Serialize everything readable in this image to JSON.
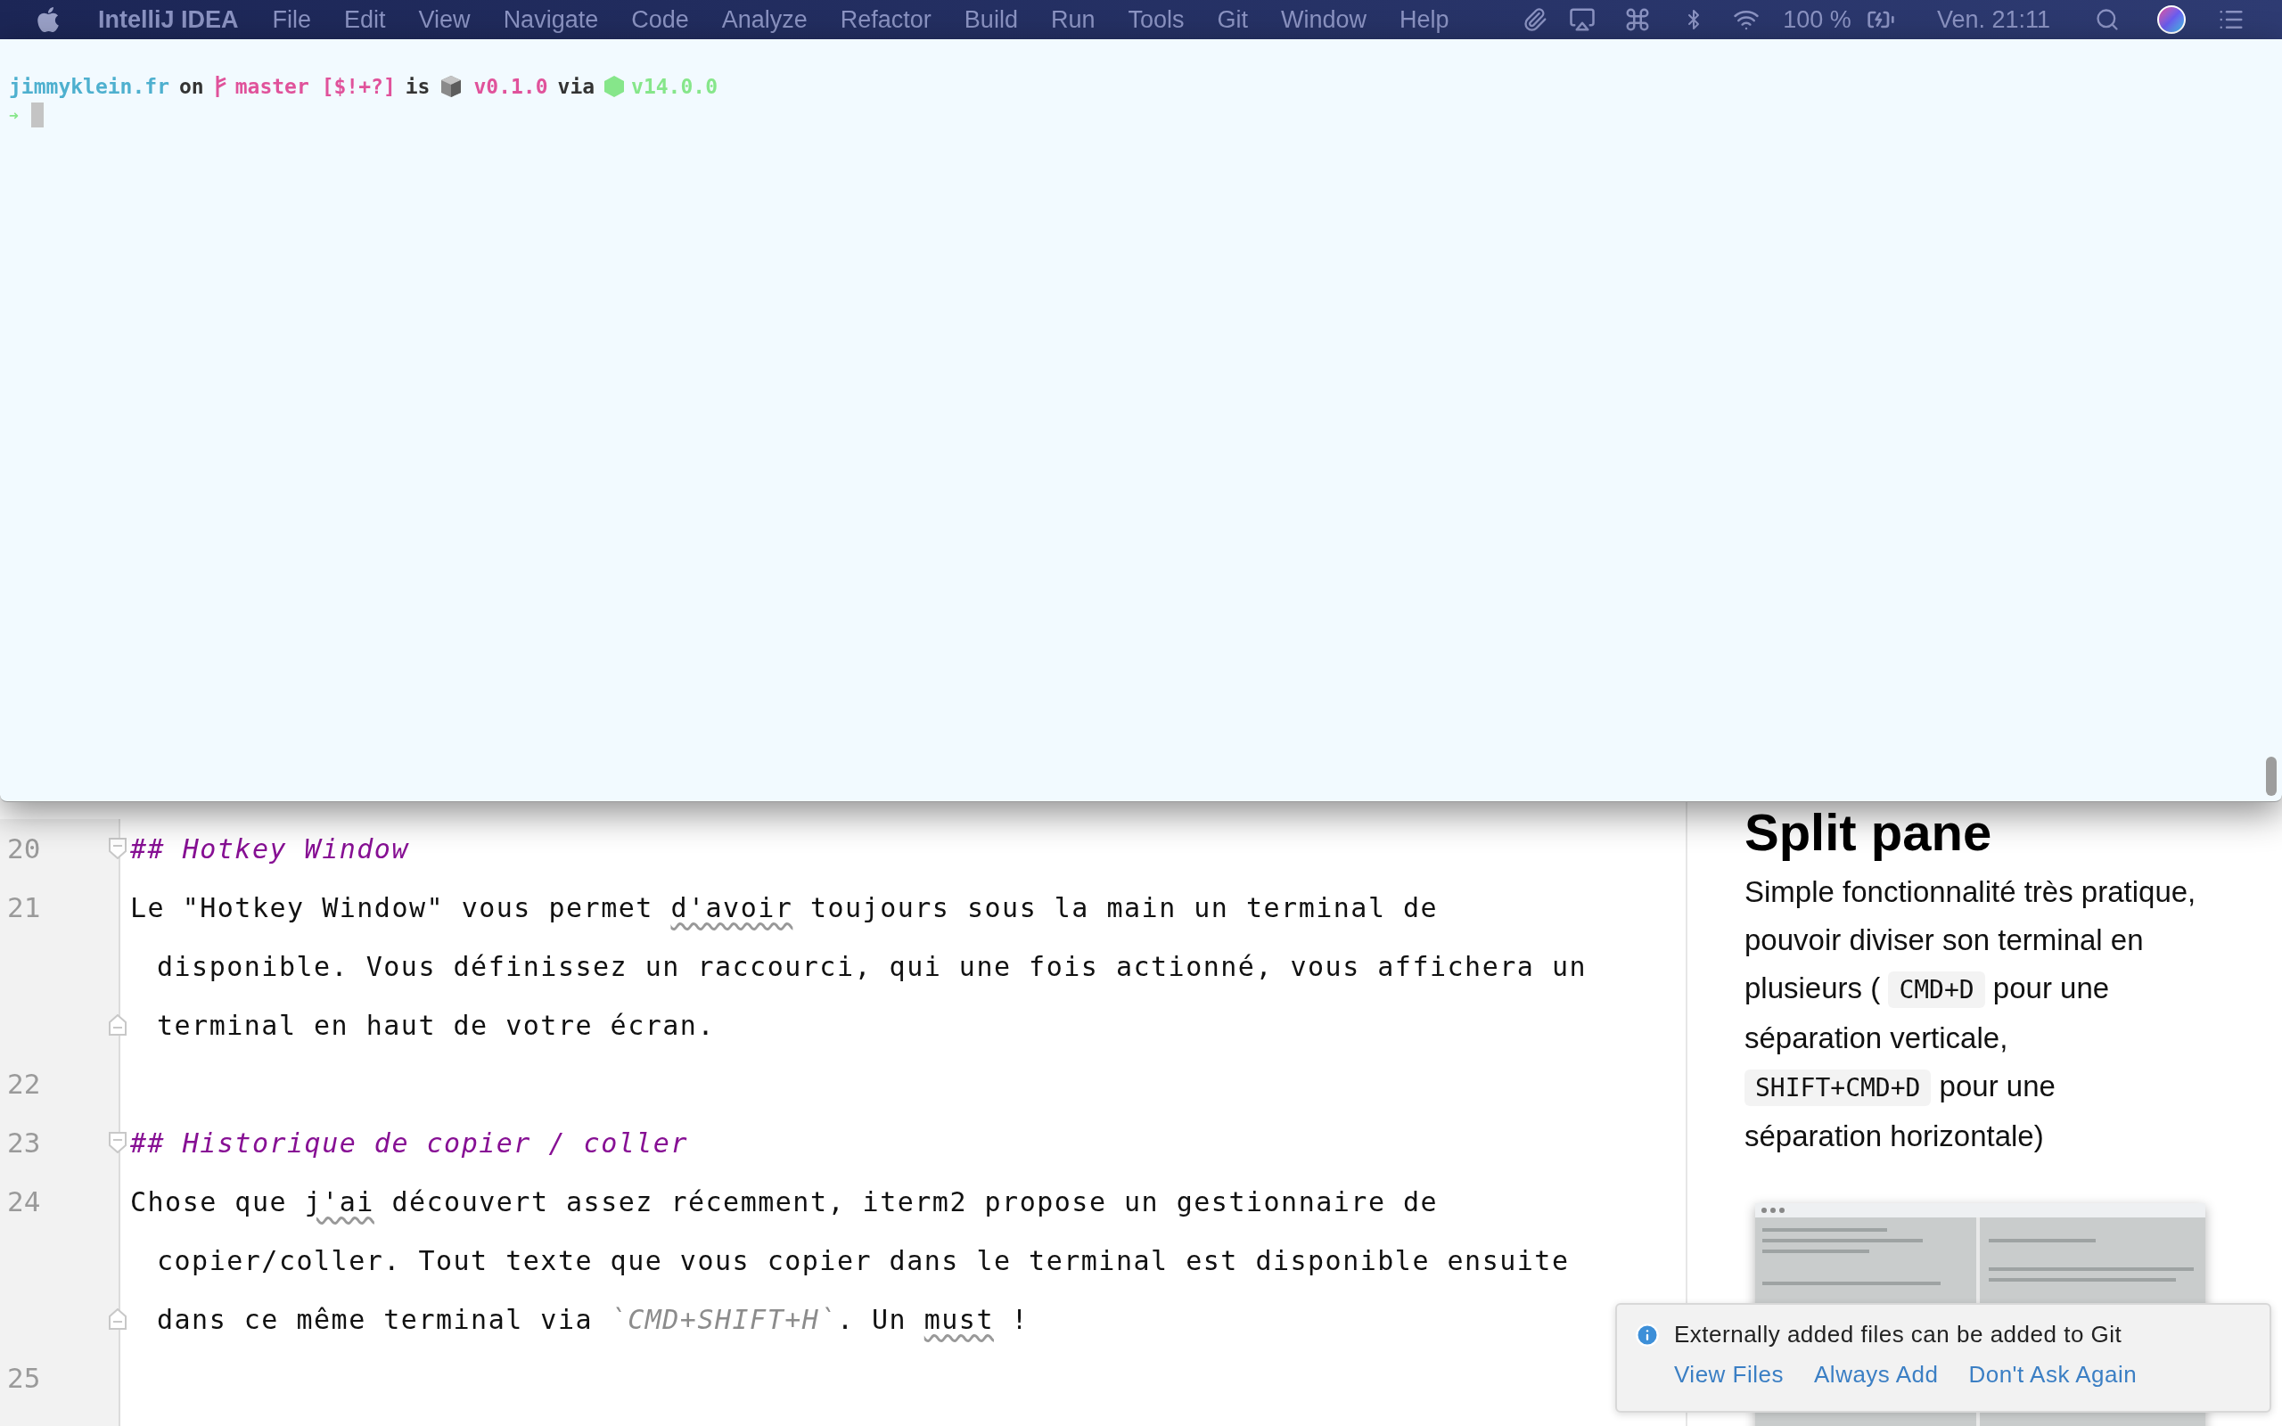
{
  "menu_bar": {
    "app": "IntelliJ IDEA",
    "items": [
      "File",
      "Edit",
      "View",
      "Navigate",
      "Code",
      "Analyze",
      "Refactor",
      "Build",
      "Run",
      "Tools",
      "Git",
      "Window",
      "Help"
    ],
    "battery": "100 %",
    "clock": "Ven. 21:11"
  },
  "terminal": {
    "prompt": [
      {
        "kind": "dir",
        "text": "jimmyklein.fr"
      },
      {
        "kind": "plain",
        "text": "on"
      },
      {
        "kind": "branch",
        "text": "master [$!+?]"
      },
      {
        "kind": "plain",
        "text": "is"
      },
      {
        "kind": "package",
        "text": "v0.1.0"
      },
      {
        "kind": "plain",
        "text": "via"
      },
      {
        "kind": "node",
        "text": "v14.0.0"
      }
    ],
    "arrow": "➜"
  },
  "editor": {
    "lines": [
      {
        "number": "20",
        "kind": "heading",
        "fold_start": true,
        "fold_end": false,
        "rows": [
          {
            "parts": [
              {
                "kind": "text",
                "text": "## Hotkey Window"
              }
            ]
          }
        ]
      },
      {
        "number": "21",
        "kind": "text",
        "fold_start": false,
        "fold_end": true,
        "rows": [
          {
            "parts": [
              {
                "kind": "text",
                "text": "Le \"Hotkey Window\" vous permet "
              },
              {
                "kind": "misspelled",
                "text": "d'avoir"
              },
              {
                "kind": "text",
                "text": " toujours sous la main un terminal de"
              }
            ]
          },
          {
            "parts": [
              {
                "kind": "text",
                "text": "disponible. Vous définissez un raccourci, qui une fois actionné, vous affichera un"
              }
            ]
          },
          {
            "parts": [
              {
                "kind": "text",
                "text": "terminal en haut de votre écran."
              }
            ]
          }
        ]
      },
      {
        "number": "22",
        "fold_start": false,
        "fold_end": false
      },
      {
        "number": "23",
        "kind": "heading",
        "fold_start": true,
        "fold_end": false,
        "rows": [
          {
            "parts": [
              {
                "kind": "text",
                "text": "## Historique de copier / coller"
              }
            ]
          }
        ]
      },
      {
        "number": "24",
        "kind": "text",
        "fold_start": false,
        "fold_end": true,
        "rows": [
          {
            "parts": [
              {
                "kind": "text",
                "text": "Chose que "
              },
              {
                "kind": "misspelled",
                "text": "j'ai"
              },
              {
                "kind": "text",
                "text": " découvert assez récemment, iterm2 propose un gestionnaire de"
              }
            ]
          },
          {
            "parts": [
              {
                "kind": "text",
                "text": "copier/coller. Tout texte que vous copier dans le terminal est disponible ensuite"
              }
            ]
          },
          {
            "parts": [
              {
                "kind": "text",
                "text": "dans ce même terminal via "
              },
              {
                "kind": "code",
                "text": "`CMD+SHIFT+H`"
              },
              {
                "kind": "text",
                "text": ". Un "
              },
              {
                "kind": "misspelled",
                "text": "must"
              },
              {
                "kind": "text",
                "text": " !"
              }
            ]
          }
        ]
      },
      {
        "number": "25",
        "fold_start": false,
        "fold_end": false
      }
    ]
  },
  "preview": {
    "heading": "Split pane",
    "rows": [
      {
        "parts": [
          {
            "kind": "text",
            "text": "Simple fonctionnalité très pratique,"
          }
        ]
      },
      {
        "parts": [
          {
            "kind": "text",
            "text": "pouvoir diviser son terminal en"
          }
        ]
      },
      {
        "parts": [
          {
            "kind": "text",
            "text": "plusieurs ( "
          },
          {
            "kind": "code",
            "text": "CMD+D"
          },
          {
            "kind": "text",
            "text": " pour une"
          }
        ]
      },
      {
        "parts": [
          {
            "kind": "text",
            "text": "séparation verticale,"
          }
        ]
      },
      {
        "parts": [
          {
            "kind": "code",
            "text": "SHIFT+CMD+D"
          },
          {
            "kind": "text",
            "text": " pour une"
          }
        ]
      },
      {
        "parts": [
          {
            "kind": "text",
            "text": "séparation horizontale)"
          }
        ]
      }
    ]
  },
  "notification": {
    "message": "Externally added files can be added to Git",
    "actions": [
      "View Files",
      "Always Add",
      "Don't Ask Again"
    ]
  }
}
